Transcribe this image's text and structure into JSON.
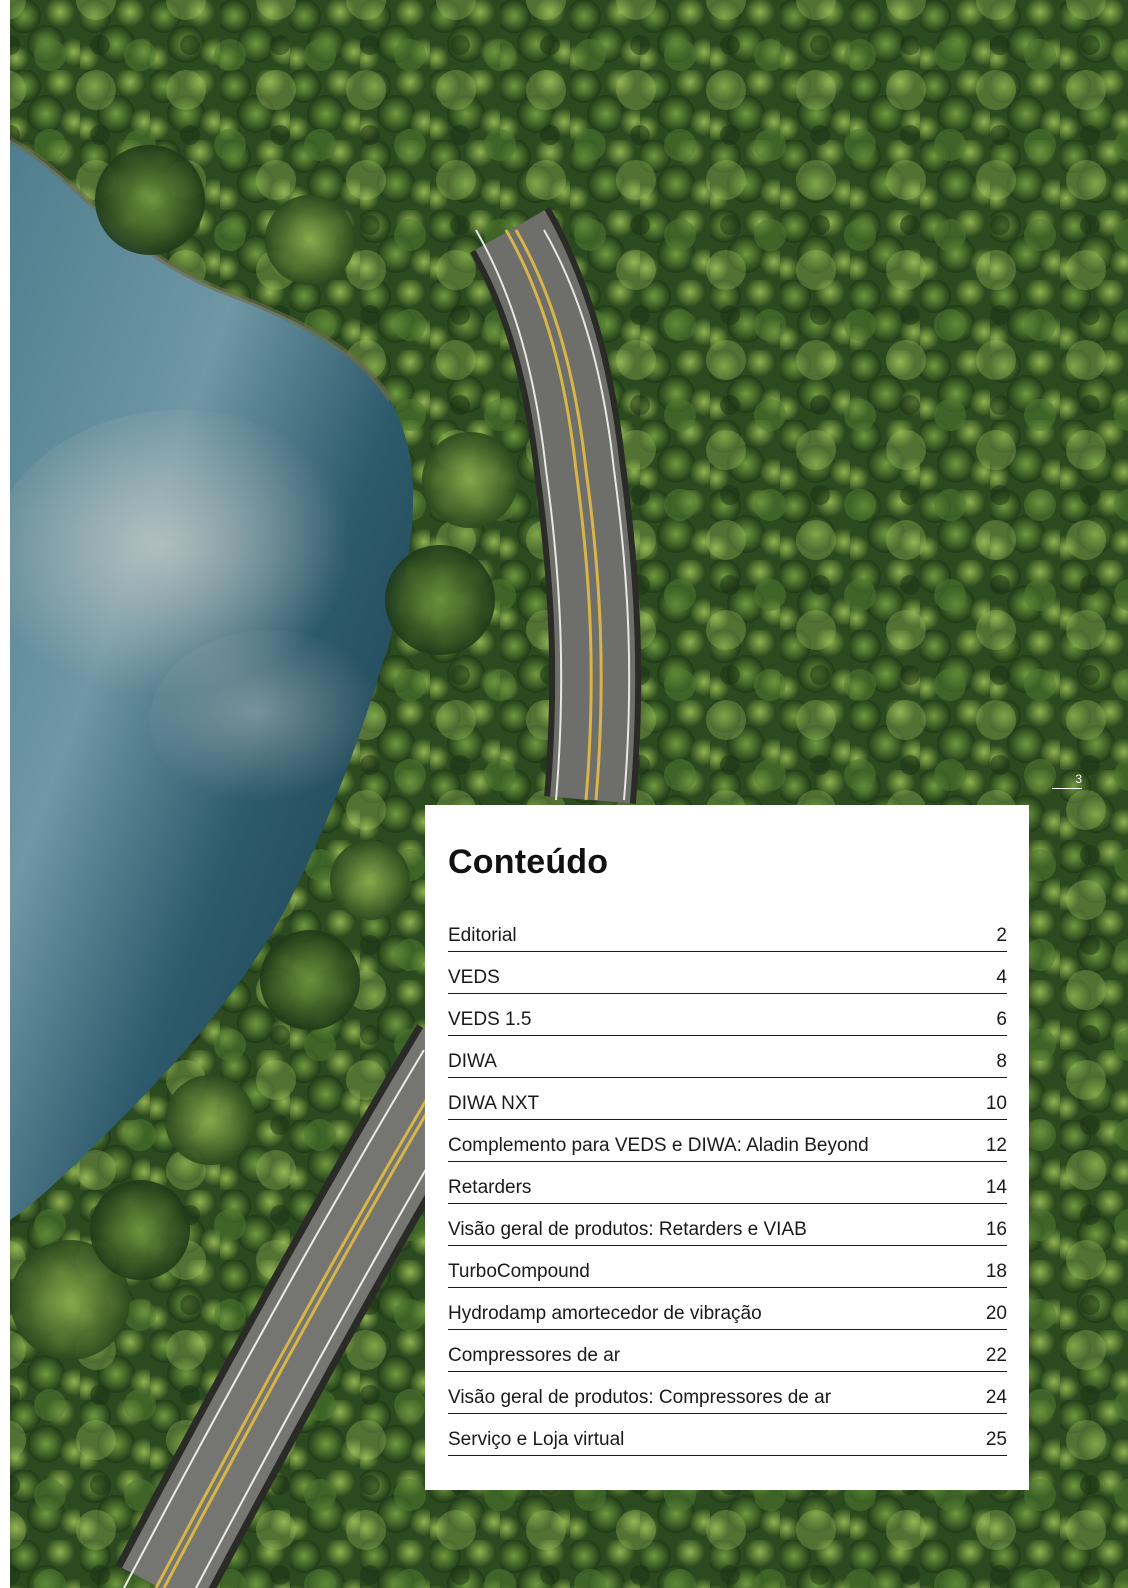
{
  "page": {
    "number": "3"
  },
  "toc": {
    "title": "Conteúdo",
    "entries": [
      {
        "label": "Editorial",
        "page": "2"
      },
      {
        "label": "VEDS",
        "page": "4"
      },
      {
        "label": "VEDS 1.5",
        "page": "6"
      },
      {
        "label": "DIWA",
        "page": "8"
      },
      {
        "label": "DIWA NXT",
        "page": "10"
      },
      {
        "label": "Complemento para VEDS e DIWA: Aladin Beyond",
        "page": "12"
      },
      {
        "label": "Retarders",
        "page": "14"
      },
      {
        "label": "Visão geral de produtos: Retarders e VIAB",
        "page": "16"
      },
      {
        "label": "TurboCompound",
        "page": "18"
      },
      {
        "label": "Hydrodamp amortecedor de vibração",
        "page": "20"
      },
      {
        "label": "Compressores de ar",
        "page": "22"
      },
      {
        "label": "Visão geral de produtos: Compressores de ar",
        "page": "24"
      },
      {
        "label": "Serviço e Loja virtual",
        "page": "25"
      }
    ]
  },
  "colors": {
    "forest_dark": "#1f3a1a",
    "forest_mid": "#3f6a2a",
    "forest_light": "#7ea04a",
    "lake": "#2c5b72",
    "road": "#6e6e6a",
    "road_line": "#d7b548",
    "card": "#ffffff",
    "text": "#1a1a1a"
  }
}
